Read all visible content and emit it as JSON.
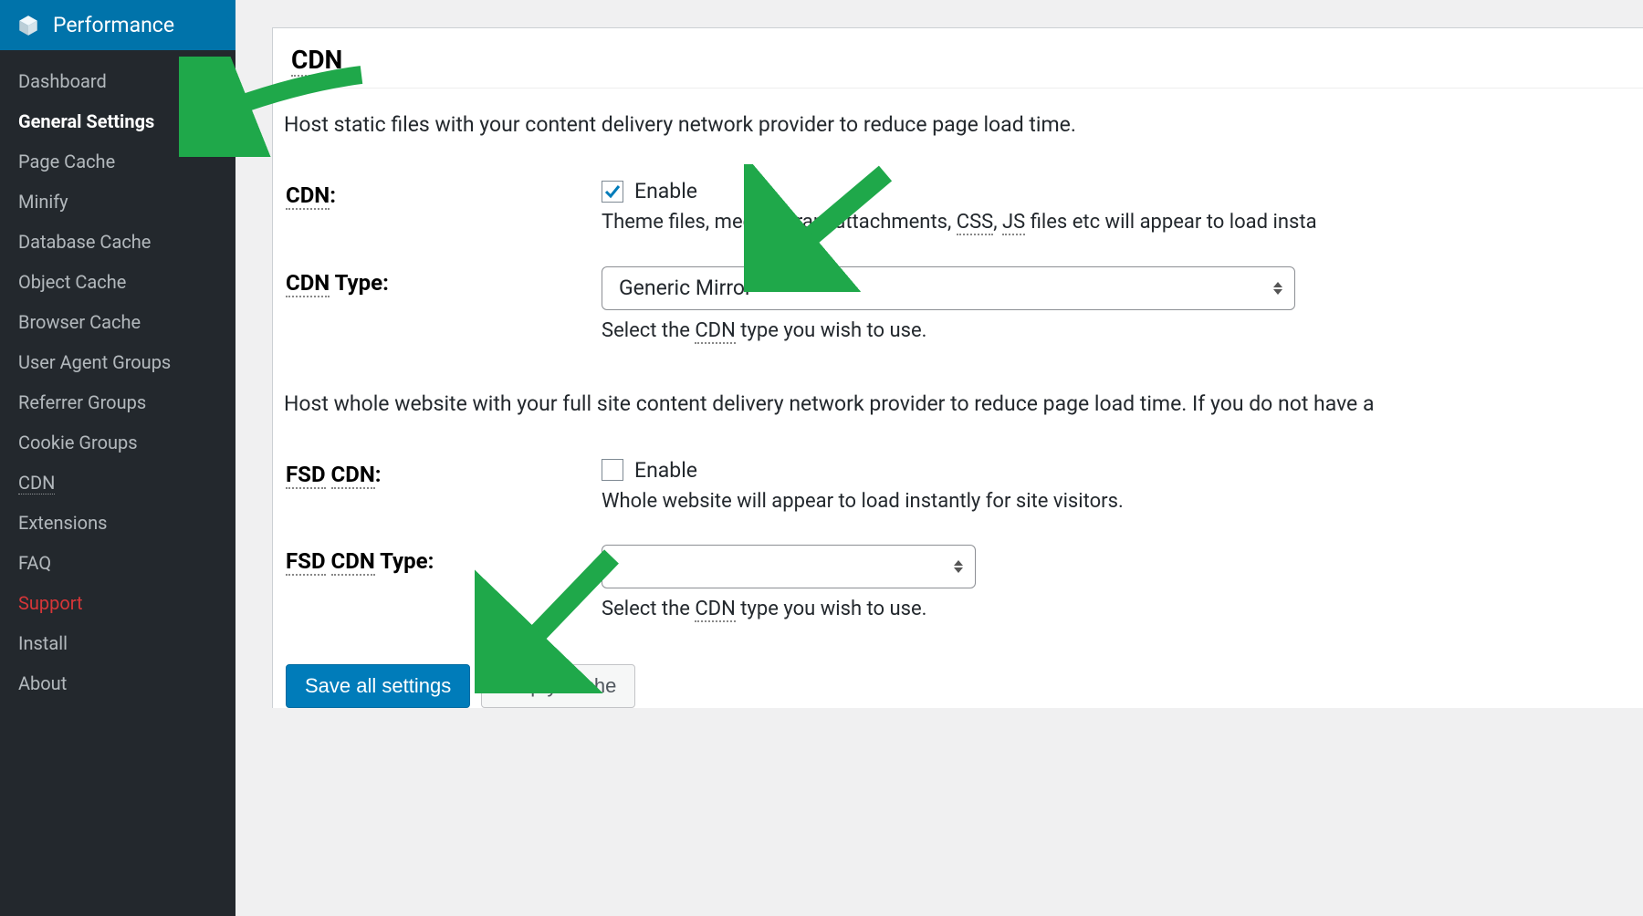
{
  "sidebar": {
    "header": "Performance",
    "items": [
      {
        "label": "Dashboard",
        "active": false
      },
      {
        "label": "General Settings",
        "active": true
      },
      {
        "label": "Page Cache",
        "active": false
      },
      {
        "label": "Minify",
        "active": false
      },
      {
        "label": "Database Cache",
        "active": false
      },
      {
        "label": "Object Cache",
        "active": false
      },
      {
        "label": "Browser Cache",
        "active": false
      },
      {
        "label": "User Agent Groups",
        "active": false
      },
      {
        "label": "Referrer Groups",
        "active": false
      },
      {
        "label": "Cookie Groups",
        "active": false
      },
      {
        "label": "CDN",
        "active": false,
        "is_abbr": true
      },
      {
        "label": "Extensions",
        "active": false
      },
      {
        "label": "FAQ",
        "active": false
      },
      {
        "label": "Support",
        "active": false,
        "support": true
      },
      {
        "label": "Install",
        "active": false
      },
      {
        "label": "About",
        "active": false
      }
    ]
  },
  "cdn": {
    "section_label": "CDN",
    "intro": "Host static files with your content delivery network provider to reduce page load time.",
    "row1_label_abbr": "CDN",
    "row1_label_suffix": ":",
    "row1_enable": "Enable",
    "row1_help_pre": "Theme files, media library attachments, ",
    "row1_help_css": "CSS",
    "row1_help_js": "JS",
    "row1_help_post": " files etc will appear to load insta",
    "row2_label_abbr": "CDN",
    "row2_label_suffix": " Type:",
    "row2_value": "Generic Mirror",
    "row2_help_pre": "Select the ",
    "row2_help_abbr": "CDN",
    "row2_help_post": " type you wish to use.",
    "intro2": "Host whole website with your full site content delivery network provider to reduce page load time. If you do not have a",
    "row3_label_fsd": "FSD",
    "row3_label_cdn": "CDN",
    "row3_label_suffix": ":",
    "row3_enable": "Enable",
    "row3_help": "Whole website will appear to load instantly for site visitors.",
    "row4_label_fsd": "FSD",
    "row4_label_cdn": "CDN",
    "row4_label_suffix": " Type:",
    "row4_value": "",
    "row4_help_pre": "Select the ",
    "row4_help_abbr": "CDN",
    "row4_help_post": " type you wish to use."
  },
  "buttons": {
    "save": "Save all settings",
    "empty": "Empty cache"
  }
}
